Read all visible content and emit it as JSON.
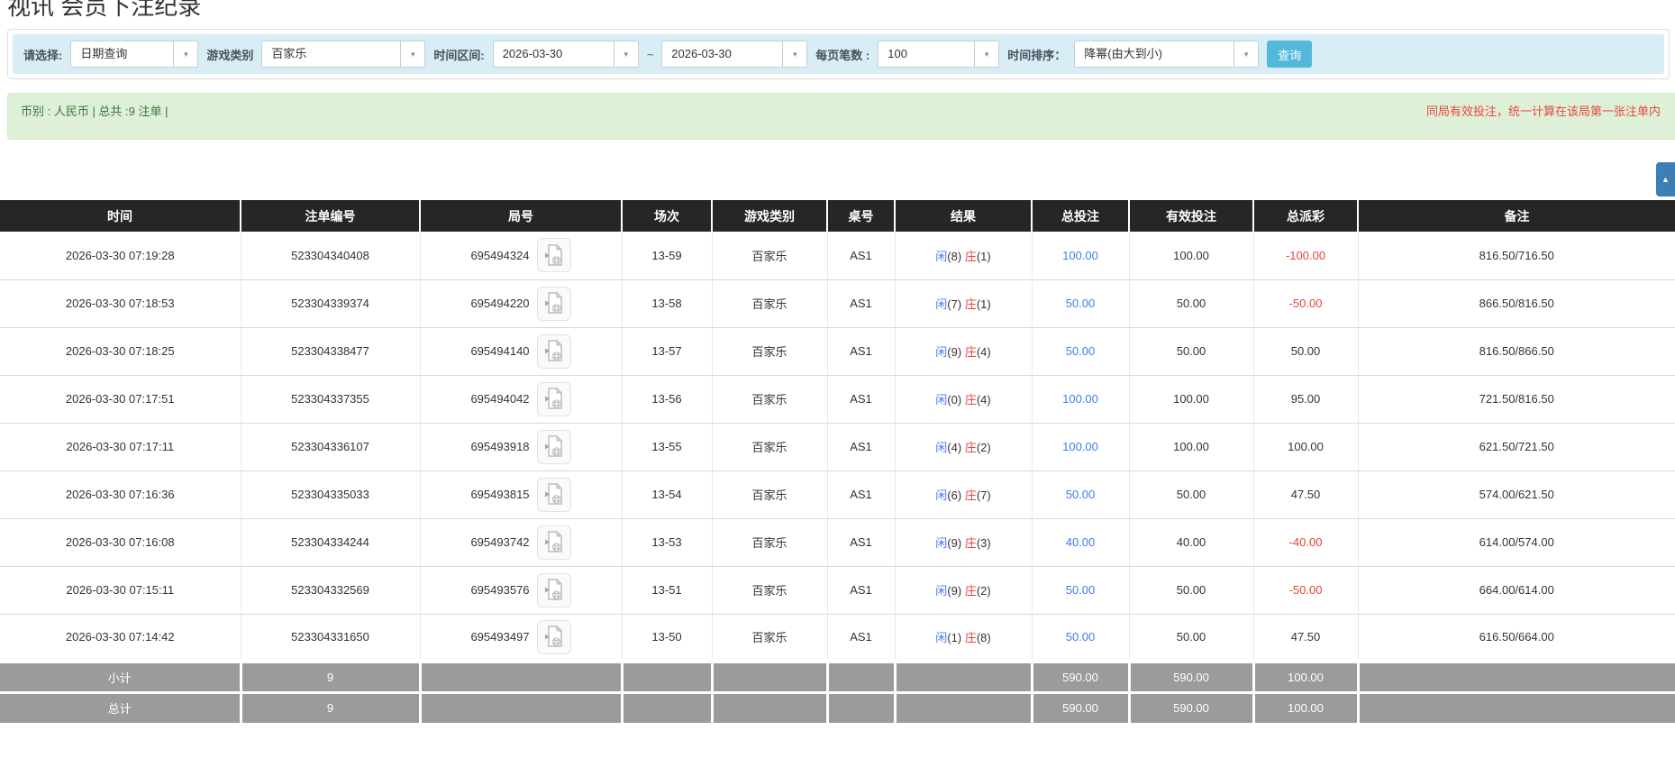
{
  "page_title": "视讯 会员下注纪录",
  "filter": {
    "select_label": "请选择:",
    "select_value": "日期查询",
    "game_label": "游戏类别",
    "game_value": "百家乐",
    "range_label": "时间区间:",
    "date_from": "2026-03-30",
    "tilde": "~",
    "date_to": "2026-03-30",
    "page_size_label": "每页笔数 :",
    "page_size_value": "100",
    "sort_label": "时间排序：",
    "sort_value": "降幂(由大到小)",
    "search_button_label": "查询"
  },
  "summary": {
    "currency_text": "币别 : 人民币 | 总共 :9 注单 |",
    "note_text": "同局有效投注，统一计算在该局第一张注单内"
  },
  "table": {
    "headers": [
      "时间",
      "注单编号",
      "局号",
      "场次",
      "游戏类别",
      "桌号",
      "结果",
      "总投注",
      "有效投注",
      "总派彩",
      "备注"
    ],
    "rows": [
      {
        "time": "2026-03-30 07:19:28",
        "bet_id": "523304340408",
        "round_id": "695494324",
        "session": "13-59",
        "game": "百家乐",
        "table": "AS1",
        "result": {
          "player": "闲",
          "player_score": "(8)",
          "banker": "庄",
          "banker_score": "(1)"
        },
        "total_bet": "100.00",
        "valid_bet": "100.00",
        "payout": "-100.00",
        "note": "816.50/716.50"
      },
      {
        "time": "2026-03-30 07:18:53",
        "bet_id": "523304339374",
        "round_id": "695494220",
        "session": "13-58",
        "game": "百家乐",
        "table": "AS1",
        "result": {
          "player": "闲",
          "player_score": "(7)",
          "banker": "庄",
          "banker_score": "(1)"
        },
        "total_bet": "50.00",
        "valid_bet": "50.00",
        "payout": "-50.00",
        "note": "866.50/816.50"
      },
      {
        "time": "2026-03-30 07:18:25",
        "bet_id": "523304338477",
        "round_id": "695494140",
        "session": "13-57",
        "game": "百家乐",
        "table": "AS1",
        "result": {
          "player": "闲",
          "player_score": "(9)",
          "banker": "庄",
          "banker_score": "(4)"
        },
        "total_bet": "50.00",
        "valid_bet": "50.00",
        "payout": "50.00",
        "note": "816.50/866.50"
      },
      {
        "time": "2026-03-30 07:17:51",
        "bet_id": "523304337355",
        "round_id": "695494042",
        "session": "13-56",
        "game": "百家乐",
        "table": "AS1",
        "result": {
          "player": "闲",
          "player_score": "(0)",
          "banker": "庄",
          "banker_score": "(4)"
        },
        "total_bet": "100.00",
        "valid_bet": "100.00",
        "payout": "95.00",
        "note": "721.50/816.50"
      },
      {
        "time": "2026-03-30 07:17:11",
        "bet_id": "523304336107",
        "round_id": "695493918",
        "session": "13-55",
        "game": "百家乐",
        "table": "AS1",
        "result": {
          "player": "闲",
          "player_score": "(4)",
          "banker": "庄",
          "banker_score": "(2)"
        },
        "total_bet": "100.00",
        "valid_bet": "100.00",
        "payout": "100.00",
        "note": "621.50/721.50"
      },
      {
        "time": "2026-03-30 07:16:36",
        "bet_id": "523304335033",
        "round_id": "695493815",
        "session": "13-54",
        "game": "百家乐",
        "table": "AS1",
        "result": {
          "player": "闲",
          "player_score": "(6)",
          "banker": "庄",
          "banker_score": "(7)"
        },
        "total_bet": "50.00",
        "valid_bet": "50.00",
        "payout": "47.50",
        "note": "574.00/621.50"
      },
      {
        "time": "2026-03-30 07:16:08",
        "bet_id": "523304334244",
        "round_id": "695493742",
        "session": "13-53",
        "game": "百家乐",
        "table": "AS1",
        "result": {
          "player": "闲",
          "player_score": "(9)",
          "banker": "庄",
          "banker_score": "(3)"
        },
        "total_bet": "40.00",
        "valid_bet": "40.00",
        "payout": "-40.00",
        "note": "614.00/574.00"
      },
      {
        "time": "2026-03-30 07:15:11",
        "bet_id": "523304332569",
        "round_id": "695493576",
        "session": "13-51",
        "game": "百家乐",
        "table": "AS1",
        "result": {
          "player": "闲",
          "player_score": "(9)",
          "banker": "庄",
          "banker_score": "(2)"
        },
        "total_bet": "50.00",
        "valid_bet": "50.00",
        "payout": "-50.00",
        "note": "664.00/614.00"
      },
      {
        "time": "2026-03-30 07:14:42",
        "bet_id": "523304331650",
        "round_id": "695493497",
        "session": "13-50",
        "game": "百家乐",
        "table": "AS1",
        "result": {
          "player": "闲",
          "player_score": "(1)",
          "banker": "庄",
          "banker_score": "(8)"
        },
        "total_bet": "50.00",
        "valid_bet": "50.00",
        "payout": "47.50",
        "note": "616.50/664.00"
      }
    ],
    "subtotal": {
      "label": "小计",
      "count": "9",
      "total_bet": "590.00",
      "valid_bet": "590.00",
      "payout": "100.00"
    },
    "total": {
      "label": "总计",
      "count": "9",
      "total_bet": "590.00",
      "valid_bet": "590.00",
      "payout": "100.00"
    }
  },
  "icons": {
    "combo_arrow": "chevron-down-icon",
    "round_video": "video-file-icon",
    "side_button": "collapse-up-icon"
  },
  "colors": {
    "accent_blue": "#3D7EEB",
    "negative_red": "#EA4335",
    "note_red": "#E8473F",
    "header_bg": "#262626",
    "subtotal_bg": "#9B9B9B",
    "filter_bg": "#D9EDF7",
    "summary_bg": "#DFF0D8",
    "search_button_bg": "#54B8DB",
    "side_button_bg": "#3D7EB5"
  }
}
